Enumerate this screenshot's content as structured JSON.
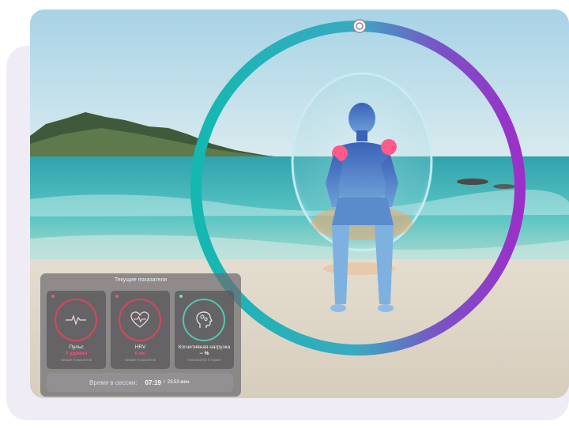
{
  "panel": {
    "title": "Текущие показатели",
    "cards": [
      {
        "label": "Пульс",
        "value": "0 уд/мин",
        "sub": "Низкие показатели",
        "icon": "heartbeat-line-icon",
        "accent": "#d9465f",
        "dot": "#ff4d7a"
      },
      {
        "label": "HRV",
        "value": "0 мс",
        "sub": "Низкие показатели",
        "icon": "heart-pulse-icon",
        "accent": "#d9465f",
        "dot": "#ff4d7a"
      },
      {
        "label": "Когнитивная нагрузка",
        "value": "-- %",
        "sub": "Показатели в норме",
        "icon": "brain-head-icon",
        "accent": "#4fc8b4",
        "dot": "#6ee0cf"
      }
    ]
  },
  "session": {
    "label": "Время в сессии:",
    "current": "07:19",
    "separator": "/",
    "total": "23:53 мин."
  },
  "ring": {
    "color_start": "#14b8b0",
    "color_end": "#9b30c8",
    "progress": 0.0
  },
  "colors": {
    "highlight": "#ff5a8a"
  }
}
